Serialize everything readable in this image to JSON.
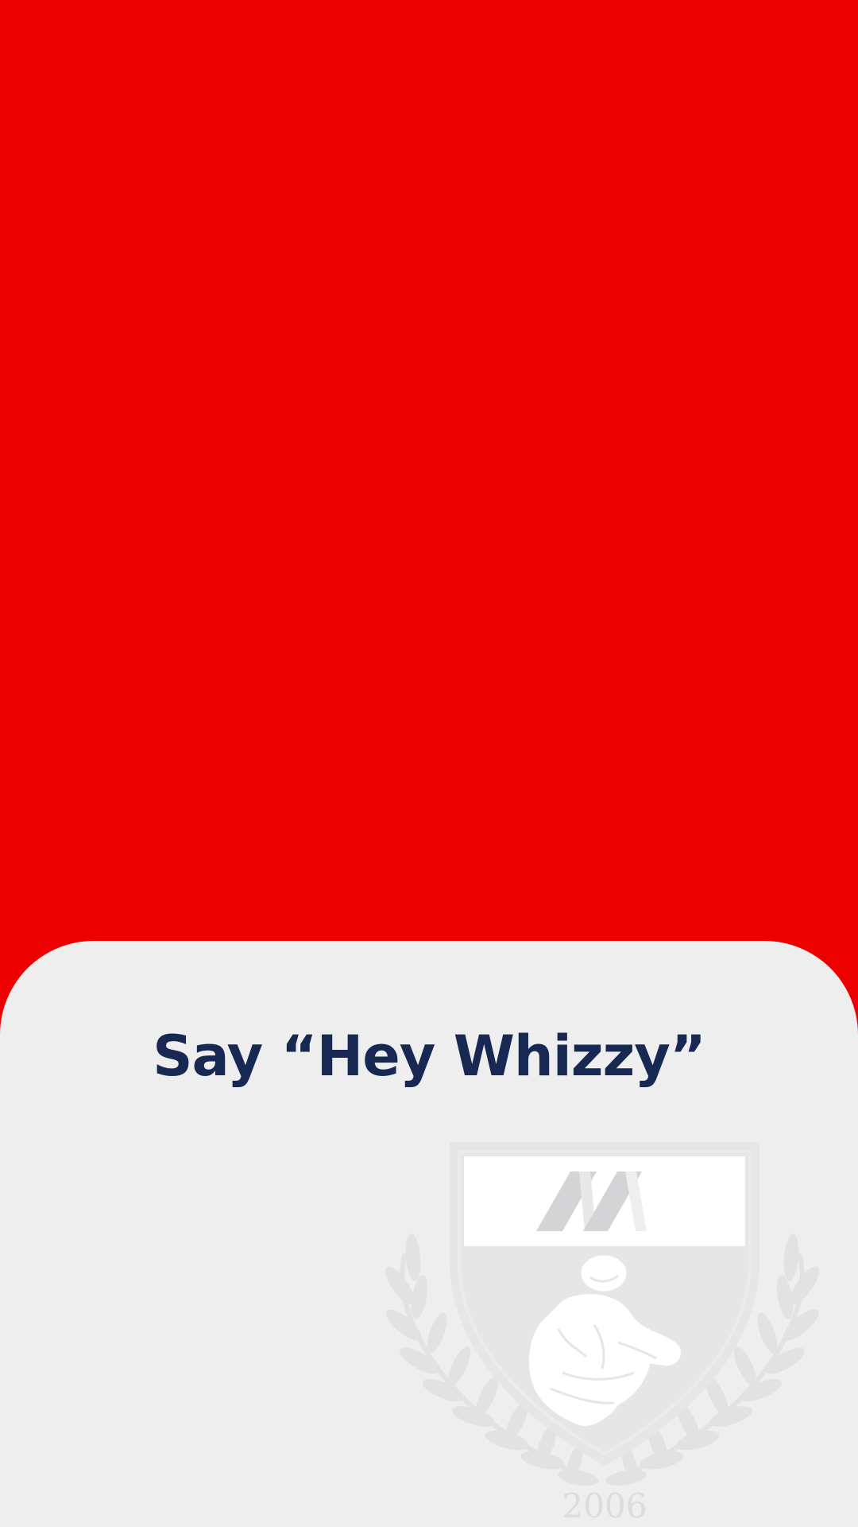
{
  "prompt": {
    "title": "Say “Hey Whizzy”"
  },
  "crest": {
    "year": "2006",
    "icon": "school-crest-icon"
  },
  "colors": {
    "top_background": "#EC0000",
    "sheet_background": "#EEEEEF",
    "title_text": "#172852"
  }
}
